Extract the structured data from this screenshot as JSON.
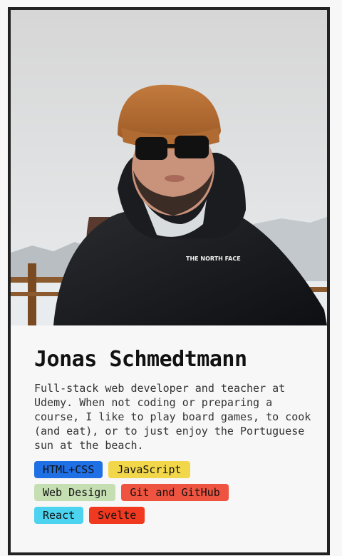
{
  "profile": {
    "name": "Jonas Schmedtmann",
    "bio": "Full-stack web developer and teacher at Udemy. When not coding or preparing a course, I like to play board games, to cook (and eat), or to just enjoy the Portuguese sun at the beach.",
    "photo_alt": "Jonas Schmedtmann",
    "photo_logo_text": "THE NORTH FACE"
  },
  "skills": [
    {
      "label": "HTML+CSS",
      "color": "#1f6fe5",
      "text_color": "#111111"
    },
    {
      "label": "JavaScript",
      "color": "#f2d74a",
      "text_color": "#111111"
    },
    {
      "label": "Web Design",
      "color": "#c5dfb3",
      "text_color": "#111111"
    },
    {
      "label": "Git and GitHub",
      "color": "#ee5440",
      "text_color": "#111111"
    },
    {
      "label": "React",
      "color": "#4cd3f0",
      "text_color": "#111111"
    },
    {
      "label": "Svelte",
      "color": "#f0391f",
      "text_color": "#111111"
    }
  ]
}
